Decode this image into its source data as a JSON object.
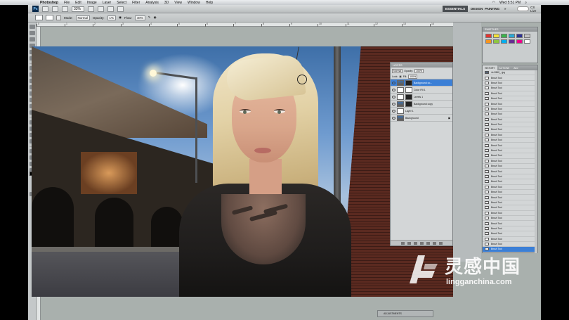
{
  "menubar": {
    "app": "Photoshop",
    "items": [
      "File",
      "Edit",
      "Image",
      "Layer",
      "Select",
      "Filter",
      "Analysis",
      "3D",
      "View",
      "Window",
      "Help"
    ],
    "clock": "Wed 5:51 PM"
  },
  "appbar": {
    "logo": "Ps",
    "zoom": "33%",
    "workspaces": [
      "ESSENTIALS",
      "DESIGN",
      "PAINTING",
      "»"
    ],
    "cs_live": "CS Live"
  },
  "options": {
    "mode_label": "Mode:",
    "mode_value": "Normal",
    "opacity_label": "Opacity:",
    "opacity_value": "1%",
    "flow_label": "Flow:",
    "flow_value": "40%"
  },
  "ruler_numbers": [
    "0",
    "1",
    "2",
    "3",
    "4",
    "5",
    "6",
    "7",
    "8",
    "9",
    "10",
    "11",
    "12",
    "13",
    "14",
    "15"
  ],
  "layers_panel": {
    "title": "LAYERS",
    "blend_mode": "Normal",
    "opacity_label": "Opacity:",
    "opacity_value": "100%",
    "lock_label": "Lock:",
    "fill_label": "Fill:",
    "fill_value": "100%",
    "layers": [
      {
        "name": "Background co..."
      },
      {
        "name": "Color Fill 1"
      },
      {
        "name": "Levels 1"
      },
      {
        "name": "Background copy"
      },
      {
        "name": "Layer 1"
      },
      {
        "name": "Background"
      }
    ]
  },
  "swatches_panel": {
    "title": "SWATCHES",
    "colors": [
      "#e4342f",
      "#f2e23a",
      "#39b54a",
      "#2aa9d6",
      "#2e3192",
      "#c2c2c2",
      "#f7941d",
      "#8dc63f",
      "#00aeef",
      "#662d91",
      "#ec008c",
      "#ffffff"
    ]
  },
  "actions_panel": {
    "tabs": [
      "HISTORY",
      "ACTIONS",
      "ADJ"
    ],
    "source": "4x-5360_..jpg",
    "items": [
      "Brush Tool",
      "Brush Tool",
      "Brush Tool",
      "Brush Tool",
      "Brush Tool",
      "Brush Tool",
      "Brush Tool",
      "Brush Tool",
      "Brush Tool",
      "Brush Tool",
      "Brush Tool",
      "Brush Tool",
      "Brush Tool",
      "Brush Tool",
      "Brush Tool",
      "Brush Tool",
      "Brush Tool",
      "Brush Tool",
      "Brush Tool",
      "Brush Tool",
      "Brush Tool",
      "Brush Tool",
      "Brush Tool",
      "Brush Tool",
      "Brush Tool",
      "Brush Tool",
      "Brush Tool",
      "Brush Tool",
      "Brush Tool",
      "Brush Tool",
      "Brush Tool",
      "Brush Tool",
      "Brush Tool",
      "Brush Tool"
    ],
    "active_item": "Brush Tool"
  },
  "bottom": {
    "adjustments_label": "ADJUSTMENTS"
  },
  "watermark": {
    "cn": "灵感中国",
    "en": "lingganchina.com"
  },
  "colors": {
    "accent": "#3b7fd6",
    "workspace_bg": "#a9b0ad",
    "essentials_bg": "#4a4e52"
  }
}
